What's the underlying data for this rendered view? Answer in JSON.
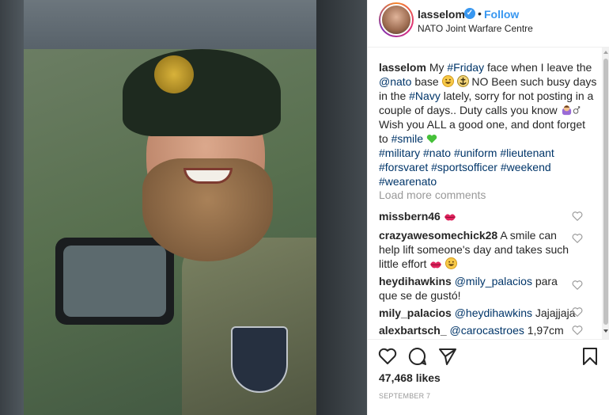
{
  "post": {
    "author": "lasselom",
    "follow_label": "Follow",
    "separator": "•",
    "location": "NATO Joint Warfare Centre",
    "verified_mark": "✓"
  },
  "caption": {
    "user": "lasselom",
    "t1": " My ",
    "tag_friday": "#Friday",
    "t2": " face when I leave the ",
    "mention_nato": "@nato",
    "t3": " base ",
    "t4": " NO Been such busy days in the ",
    "tag_navy": "#Navy",
    "t5": " lately, sorry for not posting in a couple of days.. Duty calls you know ",
    "t6": " Wish you ALL a good one, and dont forget to ",
    "tag_smile": "#smile",
    "tags": [
      "#military",
      "#nato",
      "#uniform",
      "#lieutenant",
      "#forsvaret",
      "#sportsofficer",
      "#weekend",
      "#wearenato"
    ]
  },
  "load_more": "Load more comments",
  "comments": [
    {
      "user": "missbern46",
      "text": ""
    },
    {
      "user": "crazyawesomechick28",
      "text": " A smile can help lift someone's day and takes such little effort "
    },
    {
      "user": "heydihawkins",
      "mention": "@mily_palacios",
      "text": " para que se de gustó!"
    },
    {
      "user": "mily_palacios",
      "mention": "@heydihawkins",
      "text": " Jajajjaja"
    },
    {
      "user": "alexbartsch_",
      "mention": "@carocastroes",
      "text": " 1,97cm"
    }
  ],
  "likes": "47,468 likes",
  "date": "SEPTEMBER 7",
  "icons": {
    "like": "heart-icon",
    "comment": "comment-icon",
    "share": "share-icon",
    "save": "bookmark-icon"
  }
}
